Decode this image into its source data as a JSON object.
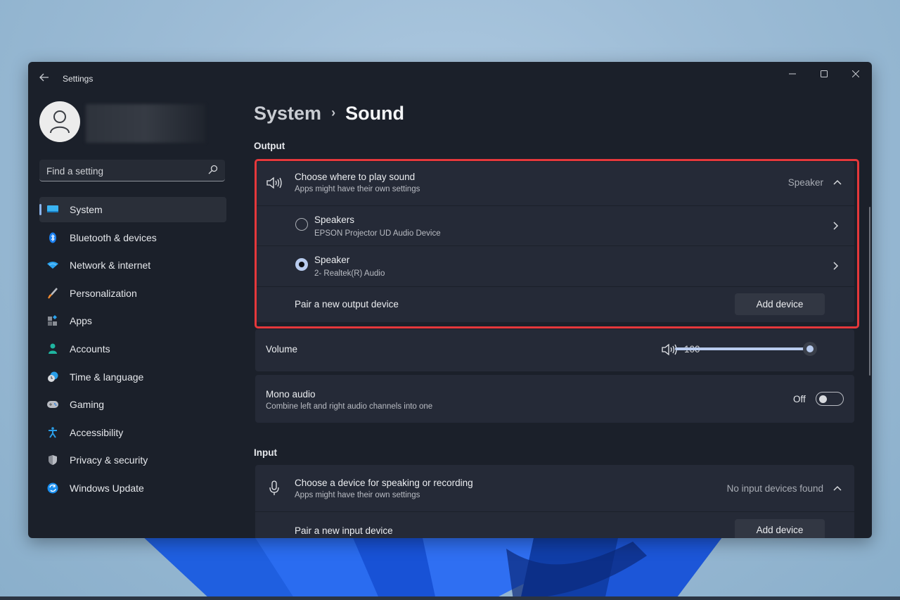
{
  "window": {
    "title": "Settings",
    "controls": {
      "minimize": "—",
      "maximize": "☐",
      "close": "✕"
    }
  },
  "sidebar": {
    "search_placeholder": "Find a setting",
    "items": [
      {
        "label": "System",
        "icon": "monitor-icon",
        "active": true
      },
      {
        "label": "Bluetooth & devices",
        "icon": "bluetooth-icon"
      },
      {
        "label": "Network & internet",
        "icon": "wifi-icon"
      },
      {
        "label": "Personalization",
        "icon": "brush-icon"
      },
      {
        "label": "Apps",
        "icon": "apps-icon"
      },
      {
        "label": "Accounts",
        "icon": "person-icon"
      },
      {
        "label": "Time & language",
        "icon": "clock-globe-icon"
      },
      {
        "label": "Gaming",
        "icon": "gamepad-icon"
      },
      {
        "label": "Accessibility",
        "icon": "accessibility-icon"
      },
      {
        "label": "Privacy & security",
        "icon": "shield-icon"
      },
      {
        "label": "Windows Update",
        "icon": "update-icon"
      }
    ]
  },
  "breadcrumb": {
    "parent": "System",
    "separator": "›",
    "current": "Sound"
  },
  "output": {
    "section_title": "Output",
    "choose": {
      "title": "Choose where to play sound",
      "subtitle": "Apps might have their own settings",
      "value": "Speaker"
    },
    "devices": [
      {
        "name": "Speakers",
        "detail": "EPSON Projector UD Audio Device",
        "selected": false
      },
      {
        "name": "Speaker",
        "detail": "2- Realtek(R) Audio",
        "selected": true
      }
    ],
    "pair": {
      "label": "Pair a new output device",
      "button": "Add device"
    },
    "volume": {
      "label": "Volume",
      "value": "100",
      "percent": 100
    },
    "mono": {
      "title": "Mono audio",
      "subtitle": "Combine left and right audio channels into one",
      "state": "Off"
    }
  },
  "input": {
    "section_title": "Input",
    "choose": {
      "title": "Choose a device for speaking or recording",
      "subtitle": "Apps might have their own settings",
      "value": "No input devices found"
    },
    "pair": {
      "label": "Pair a new input device",
      "button": "Add device"
    }
  },
  "colors": {
    "accent": "#b8cbee",
    "highlight": "#e5383b"
  }
}
